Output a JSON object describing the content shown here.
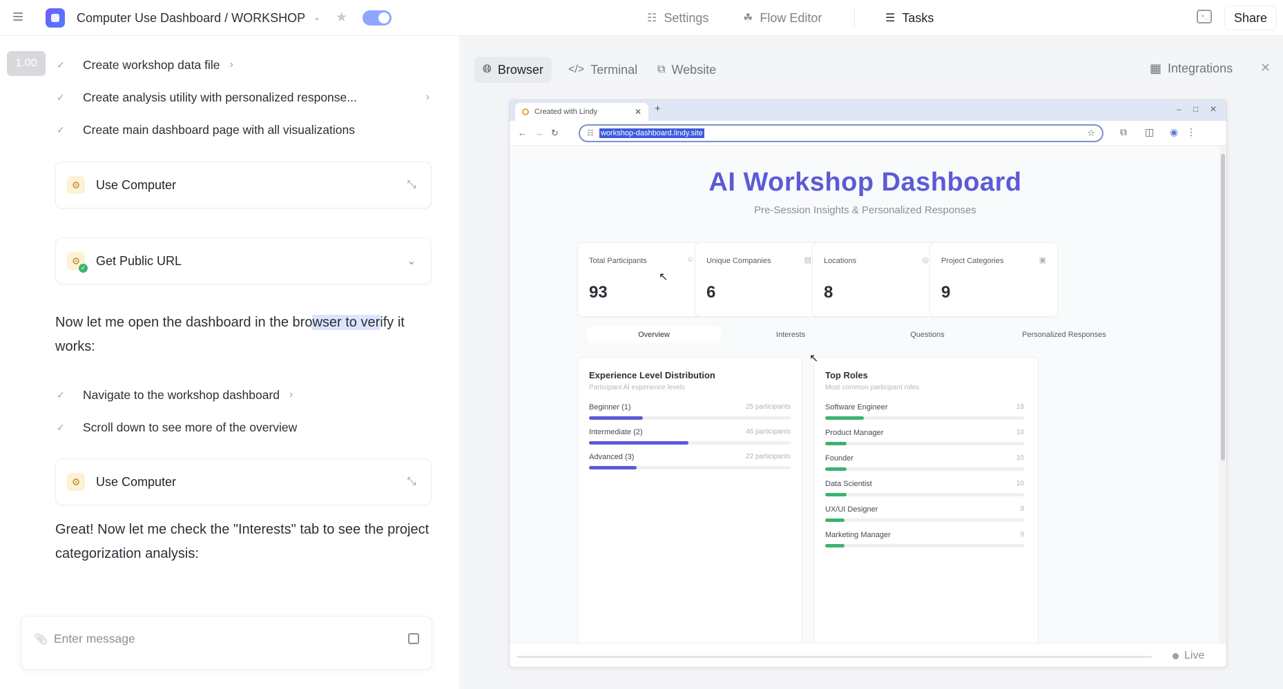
{
  "header": {
    "title": "Computer Use Dashboard / WORKSHOP",
    "nav": [
      {
        "label": "Settings",
        "icon": "sliders-icon"
      },
      {
        "label": "Flow Editor",
        "icon": "flow-icon"
      },
      {
        "label": "Tasks",
        "icon": "clipboard-icon"
      }
    ],
    "share_label": "Share"
  },
  "left": {
    "zoom": "1.00",
    "tasks_top": [
      {
        "label": "Create workshop data file"
      },
      {
        "label": "Create analysis utility with personalized response..."
      },
      {
        "label": "Create main dashboard page with all visualizations"
      }
    ],
    "card_use_computer_1": "Use Computer",
    "card_public_url": "Get Public URL",
    "para1_a": "Now let me open the dashboard in the bro",
    "para1_hl": "wser to ver",
    "para1_b": "ify it works:",
    "tasks_mid": [
      {
        "label": "Navigate to the workshop dashboard"
      },
      {
        "label": "Scroll down to see more of the overview"
      }
    ],
    "card_use_computer_2": "Use Computer",
    "para2": "Great! Now let me check the \"Interests\" tab to see the project categorization analysis:",
    "message_placeholder": "Enter message"
  },
  "right": {
    "tabs": [
      {
        "label": "Browser",
        "icon": "globe-icon"
      },
      {
        "label": "Terminal",
        "icon": "code-icon"
      },
      {
        "label": "Website",
        "icon": "external-link-icon"
      }
    ],
    "integrations_label": "Integrations",
    "browser": {
      "tab_title": "Created with Lindy",
      "url": "workshop-dashboard.lindy.site",
      "live_label": "Live",
      "page": {
        "title": "AI Workshop Dashboard",
        "subtitle": "Pre-Session Insights & Personalized Responses",
        "stats": [
          {
            "label": "Total Participants",
            "value": "93",
            "icon": "users-icon"
          },
          {
            "label": "Unique Companies",
            "value": "6",
            "icon": "building-icon"
          },
          {
            "label": "Locations",
            "value": "8",
            "icon": "map-pin-icon"
          },
          {
            "label": "Project Categories",
            "value": "9",
            "icon": "layers-icon"
          }
        ],
        "tabs": [
          "Overview",
          "Interests",
          "Questions",
          "Personalized Responses"
        ],
        "experience": {
          "title": "Experience Level Distribution",
          "subtitle": "Participant AI experience levels",
          "rows": [
            {
              "label": "Beginner (1)",
              "value": "25 participants",
              "count": 25
            },
            {
              "label": "Intermediate (2)",
              "value": "46 participants",
              "count": 46
            },
            {
              "label": "Advanced (3)",
              "value": "22 participants",
              "count": 22
            }
          ],
          "bar_color": "#5b5bd6"
        },
        "roles": {
          "title": "Top Roles",
          "subtitle": "Most common participant roles",
          "rows": [
            {
              "label": "Software Engineer",
              "value": "18",
              "count": 18
            },
            {
              "label": "Product Manager",
              "value": "10",
              "count": 10
            },
            {
              "label": "Founder",
              "value": "10",
              "count": 10
            },
            {
              "label": "Data Scientist",
              "value": "10",
              "count": 10
            },
            {
              "label": "UX/UI Designer",
              "value": "9",
              "count": 9
            },
            {
              "label": "Marketing Manager",
              "value": "9",
              "count": 9
            }
          ],
          "bar_color": "#3cb371"
        }
      }
    }
  }
}
